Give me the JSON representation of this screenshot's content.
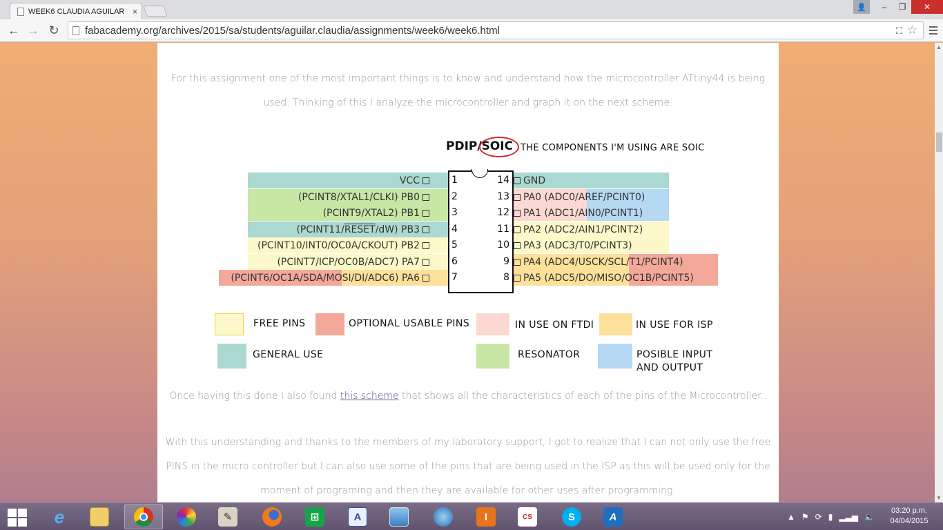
{
  "browser": {
    "tab_title": "WEEK6 CLAUDIA AGUILAR",
    "tab_close": "×",
    "url": "fabacademy.org/archives/2015/sa/students/aguilar.claudia/assignments/week6/week6.html",
    "window_controls": {
      "user": "👤",
      "minimize": "–",
      "maximize": "❐",
      "close": "✕"
    },
    "nav": {
      "back": "←",
      "forward": "→",
      "reload": "↻",
      "star": "☆",
      "translate": "⛶"
    }
  },
  "page": {
    "intro_line1": "For this assignment one of the most important things is to know and understand how the microcontroller ATtiny44 is being",
    "intro_line2": "used. Thinking of this I analyze the microcontroller and graph it on the next scheme.",
    "found_before": "Once having this done I also found ",
    "found_link": "this scheme",
    "found_after": " that shows all the characteristics of each of the pins of the Microcontroller..",
    "understand_line1": "With this understanding and thanks to the members of my laboratory support, I got to realize that I can not only use the free",
    "understand_line2": "PINS in the micro controller but I can also use some of the pins that are being used in the ISP as this will be used only for the",
    "understand_line3": "moment of programing and then they are available for other uses after programming."
  },
  "scheme": {
    "package_title": "PDIP/SOIC",
    "package_note": "THE COMPONENTS I'M USING ARE SOIC",
    "left_pins": [
      {
        "num": "1",
        "label": "VCC"
      },
      {
        "num": "2",
        "label": "(PCINT8/XTAL1/CLKI) PB0"
      },
      {
        "num": "3",
        "label": "(PCINT9/XTAL2) PB1"
      },
      {
        "num": "4",
        "label_pre": "(PCINT11/",
        "label_over": "RESET",
        "label_post": "/dW) PB3"
      },
      {
        "num": "5",
        "label": "(PCINT10/INT0/OC0A/CKOUT) PB2"
      },
      {
        "num": "6",
        "label": "(PCINT7/ICP/OC0B/ADC7) PA7"
      },
      {
        "num": "7",
        "label": "(PCINT6/OC1A/SDA/MOSI/DI/ADC6) PA6"
      }
    ],
    "right_pins": [
      {
        "num": "14",
        "label": "GND"
      },
      {
        "num": "13",
        "label": "PA0 (ADC0/AREF/PCINT0)"
      },
      {
        "num": "12",
        "label": "PA1 (ADC1/AIN0/PCINT1)"
      },
      {
        "num": "11",
        "label": "PA2 (ADC2/AIN1/PCINT2)"
      },
      {
        "num": "10",
        "label": "PA3 (ADC3/T0/PCINT3)"
      },
      {
        "num": "9",
        "label": "PA4 (ADC4/USCK/SCL/T1/PCINT4)"
      },
      {
        "num": "8",
        "label": "PA5 (ADC5/DO/MISO/OC1B/PCINT5)"
      }
    ],
    "legend": {
      "free_pins": "FREE PINS",
      "optional_usable": "OPTIONAL USABLE PINS",
      "in_use_ftdi": "IN USE ON FTDI",
      "in_use_isp": "IN USE FOR ISP",
      "general_use": "GENERAL USE",
      "resonator": "RESONATOR",
      "posible_io_1": "POSIBLE INPUT",
      "posible_io_2": "AND OUTPUT"
    },
    "colors": {
      "general_use": "#abd9d1",
      "resonator": "#c8e6a4",
      "free_pins": "#fdf8c9",
      "isp": "#fde19a",
      "optional": "#f4a89a",
      "ftdi": "#fbd8d2",
      "posible_io": "#b5d8f3"
    }
  },
  "taskbar": {
    "apps": [
      "windows-explorer",
      "internet-explorer",
      "file-explorer",
      "chrome",
      "picasa",
      "scanner",
      "firefox",
      "store",
      "word",
      "photo-viewer",
      "earth-browser",
      "illustrator-pro",
      "cs-eagle",
      "skype",
      "autodesk"
    ],
    "clock_time": "03:20 p.m.",
    "clock_date": "04/04/2015"
  }
}
